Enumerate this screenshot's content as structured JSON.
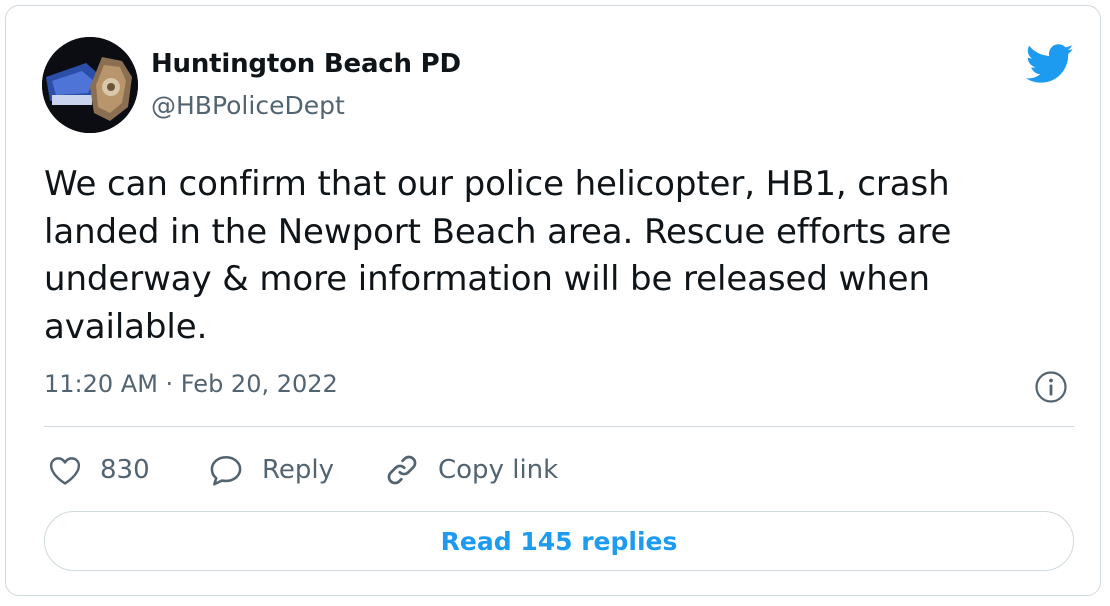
{
  "author": {
    "display_name": "Huntington Beach PD",
    "handle": "@HBPoliceDept"
  },
  "tweet": {
    "text": "We can confirm that our police helicopter, HB1, crash landed in the Newport Beach area. Rescue efforts are underway & more information will be released when available.",
    "timestamp": "11:20 AM · Feb 20, 2022"
  },
  "actions": {
    "like_count": "830",
    "reply_label": "Reply",
    "copy_link_label": "Copy link"
  },
  "read_replies_label": "Read 145 replies",
  "icons": {
    "brand": "twitter-bird-icon",
    "like": "heart-icon",
    "reply": "speech-bubble-icon",
    "copy": "link-icon",
    "info": "info-icon"
  },
  "colors": {
    "accent": "#1d9bf0",
    "text_primary": "#0f1419",
    "text_secondary": "#536471",
    "border": "#cfd9de"
  }
}
